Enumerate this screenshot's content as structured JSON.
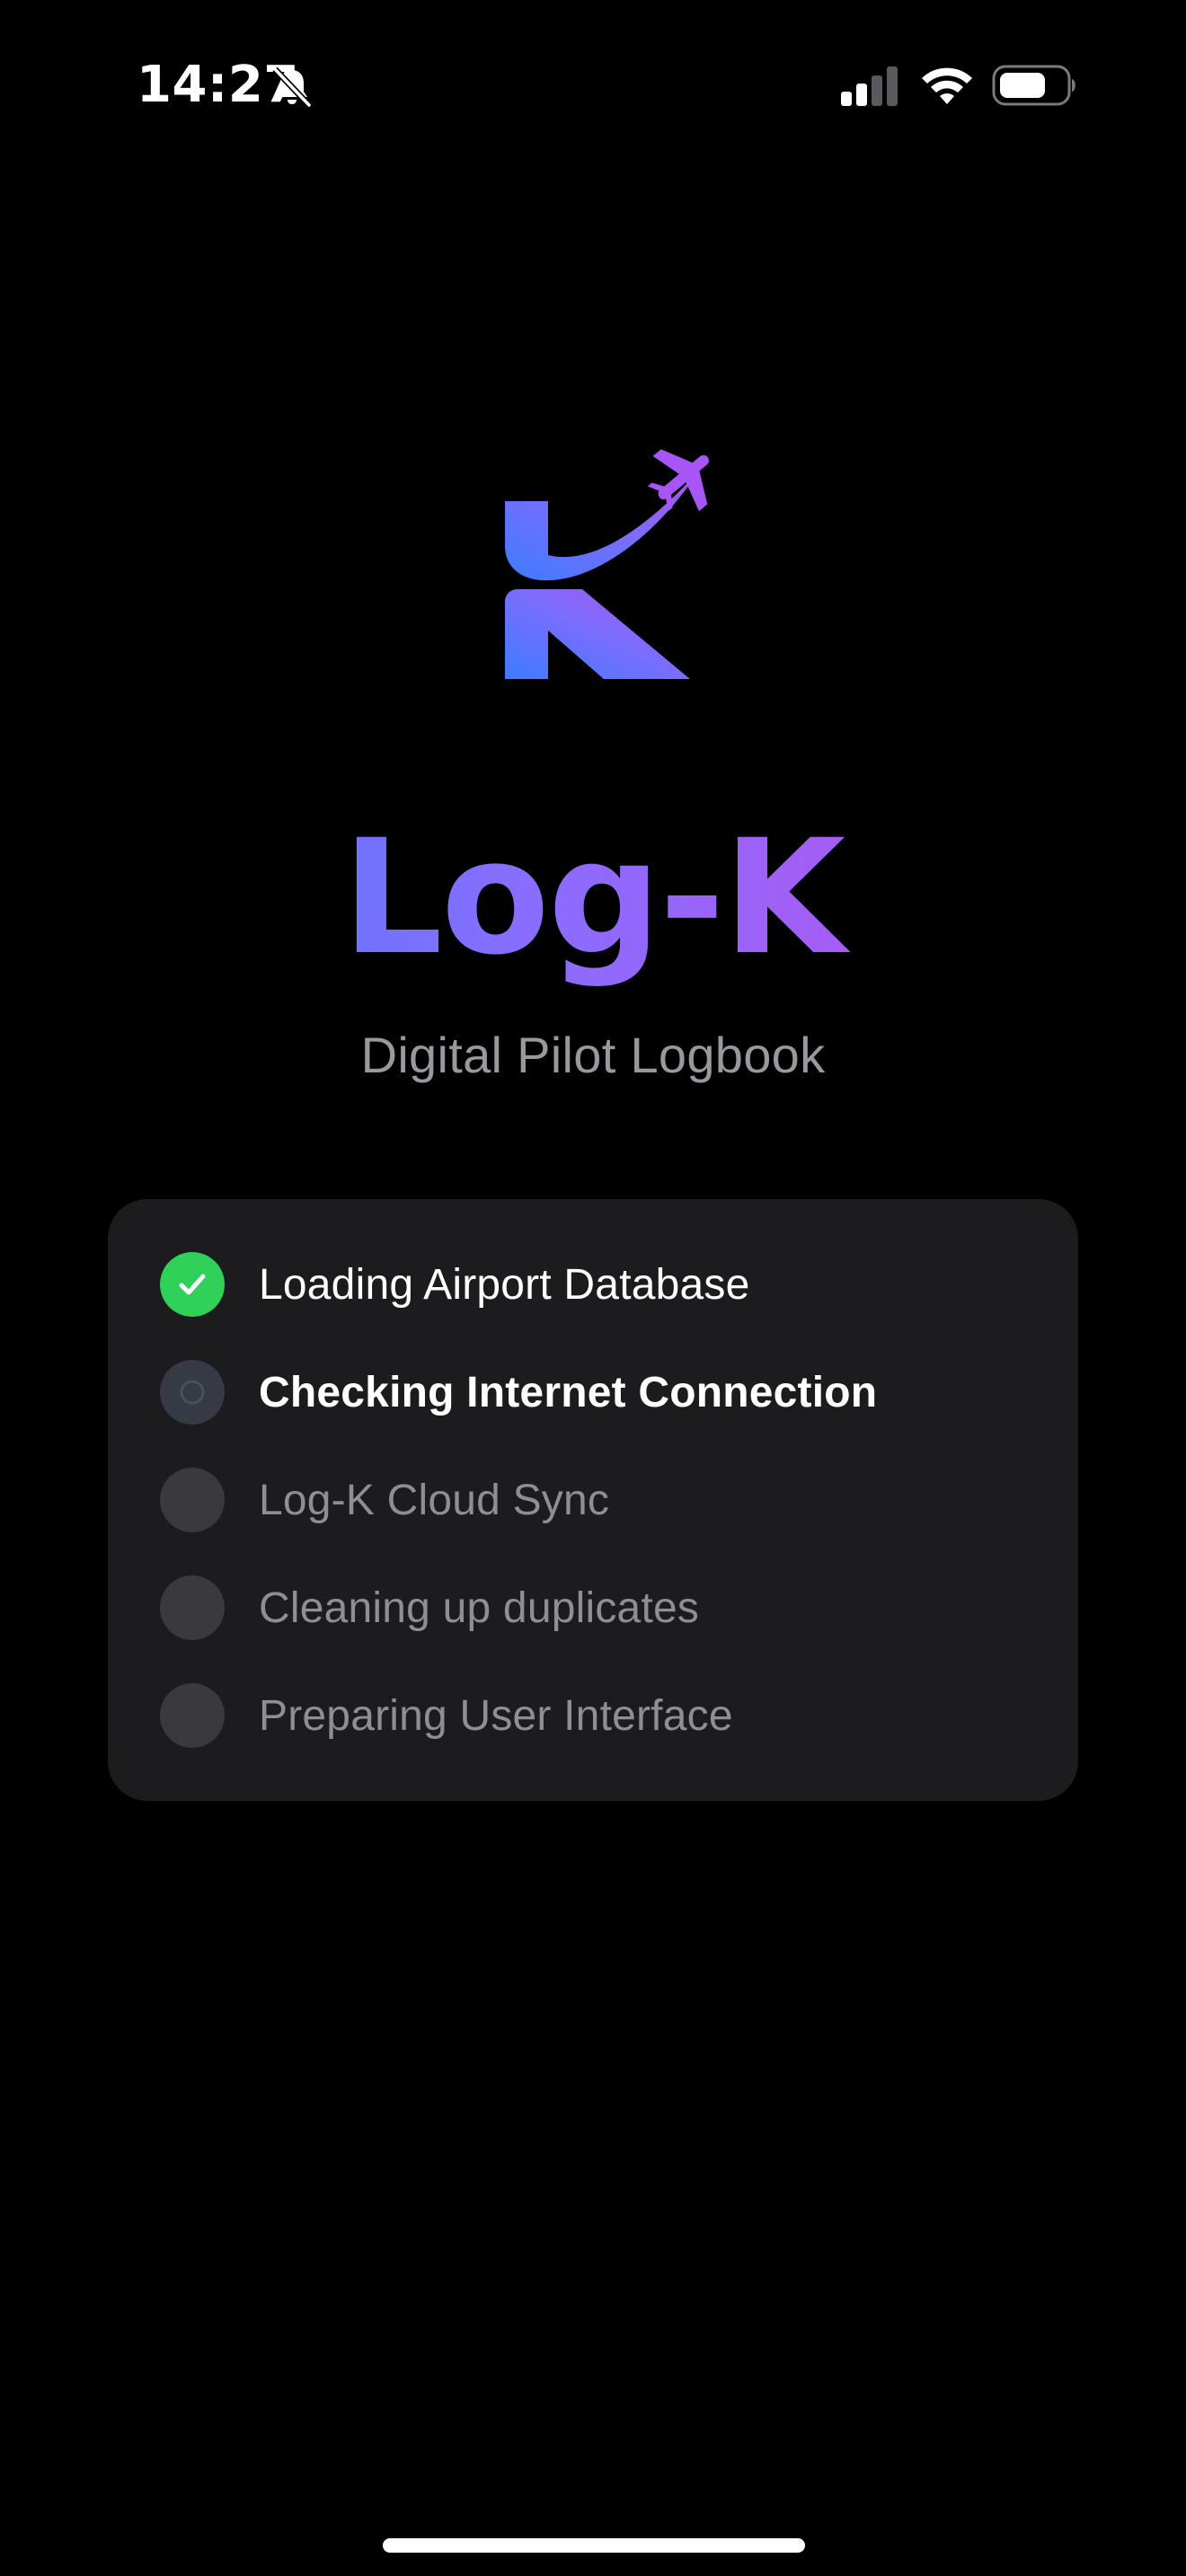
{
  "status_bar": {
    "time": "14:27",
    "icons": [
      "bell-slash-icon",
      "cellular-signal-icon",
      "wifi-icon",
      "battery-icon"
    ]
  },
  "app": {
    "name": "Log-K",
    "subtitle": "Digital Pilot Logbook",
    "gradient": [
      "#3d7bff",
      "#8a6dff",
      "#c24ce8"
    ]
  },
  "loading": {
    "steps": [
      {
        "label": "Loading Airport Database",
        "state": "done"
      },
      {
        "label": "Checking Internet Connection",
        "state": "active"
      },
      {
        "label": "Log-K Cloud Sync",
        "state": "pending"
      },
      {
        "label": "Cleaning up duplicates",
        "state": "pending"
      },
      {
        "label": "Preparing User Interface",
        "state": "pending"
      }
    ]
  },
  "colors": {
    "background": "#000000",
    "card": "#1c1c1e",
    "done": "#30d158",
    "pending_indicator": "#3a3a3c",
    "pending_text": "#8e8e93",
    "subtitle_text": "#98989e"
  }
}
